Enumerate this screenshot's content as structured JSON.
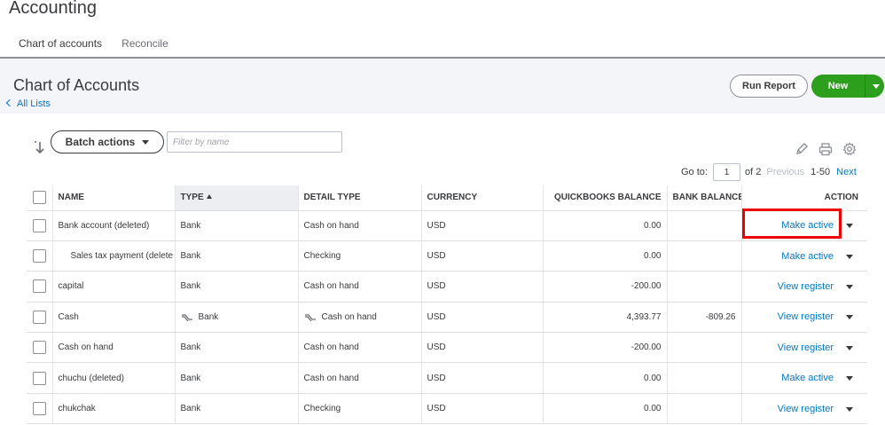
{
  "app": {
    "title": "Accounting"
  },
  "tabs": [
    {
      "label": "Chart of accounts",
      "active": true
    },
    {
      "label": "Reconcile",
      "active": false
    }
  ],
  "page": {
    "title": "Chart of Accounts",
    "back_link": "All Lists"
  },
  "buttons": {
    "run_report": "Run Report",
    "new": "New",
    "batch_actions": "Batch actions"
  },
  "filter": {
    "placeholder": "Filter by name",
    "value": ""
  },
  "toolbar_icons": [
    "pencil-icon",
    "printer-icon",
    "gear-icon"
  ],
  "pagination": {
    "goto_label": "Go to:",
    "page": "1",
    "of_label": "of 2",
    "previous": "Previous",
    "range": "1-50",
    "next": "Next"
  },
  "table": {
    "columns": [
      "NAME",
      "TYPE",
      "DETAIL TYPE",
      "CURRENCY",
      "QUICKBOOKS BALANCE",
      "BANK BALANCE",
      "ACTION"
    ],
    "sorted_column": "TYPE",
    "rows": [
      {
        "name": "Bank account (deleted)",
        "type": "Bank",
        "detail": "Cash on hand",
        "currency": "USD",
        "qb_balance": "0.00",
        "bank_balance": "",
        "action": "Make active"
      },
      {
        "name": "Sales tax payment (delete",
        "type": "Bank",
        "detail": "Checking",
        "currency": "USD",
        "qb_balance": "0.00",
        "bank_balance": "",
        "action": "Make active"
      },
      {
        "name": "capital",
        "type": "Bank",
        "detail": "Cash on hand",
        "currency": "USD",
        "qb_balance": "-200.00",
        "bank_balance": "",
        "action": "View register"
      },
      {
        "name": "Cash",
        "type": "Bank",
        "detail": "Cash on hand",
        "currency": "USD",
        "qb_balance": "4,393.77",
        "bank_balance": "-809.26",
        "action": "View register"
      },
      {
        "name": "Cash on hand",
        "type": "Bank",
        "detail": "Cash on hand",
        "currency": "USD",
        "qb_balance": "-200.00",
        "bank_balance": "",
        "action": "View register"
      },
      {
        "name": "chuchu (deleted)",
        "type": "Bank",
        "detail": "Cash on hand",
        "currency": "USD",
        "qb_balance": "0.00",
        "bank_balance": "",
        "action": "Make active"
      },
      {
        "name": "chukchak",
        "type": "Bank",
        "detail": "Checking",
        "currency": "USD",
        "qb_balance": "0.00",
        "bank_balance": "",
        "action": "View register"
      }
    ]
  },
  "colors": {
    "accent_green": "#2ca01c",
    "link_blue": "#0077c5",
    "highlight_red": "#e00000"
  }
}
